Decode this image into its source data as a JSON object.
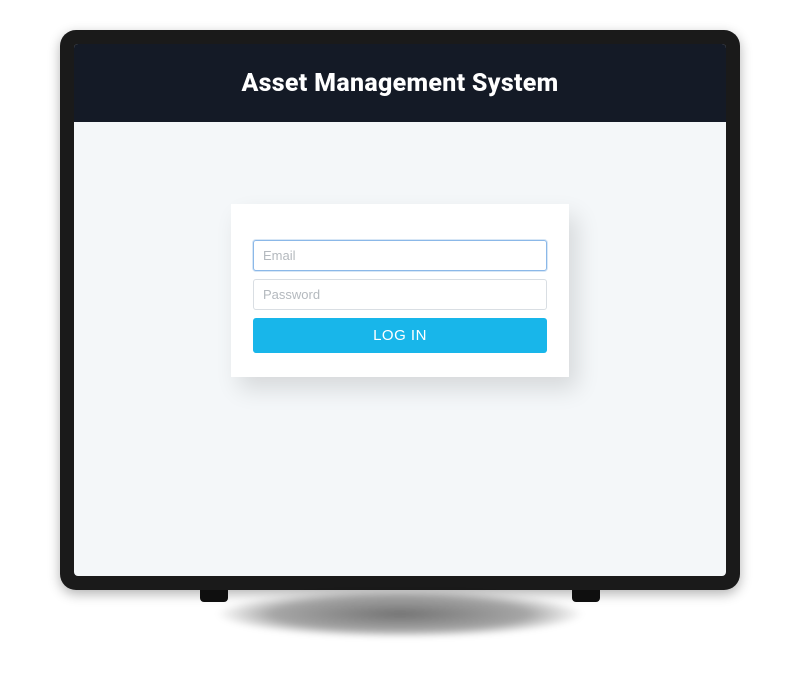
{
  "header": {
    "title": "Asset Management System"
  },
  "login": {
    "email_placeholder": "Email",
    "password_placeholder": "Password",
    "button_label": "LOG IN"
  },
  "colors": {
    "header_bg": "#141a26",
    "page_bg": "#f4f7f9",
    "button_bg": "#18b6ea"
  }
}
